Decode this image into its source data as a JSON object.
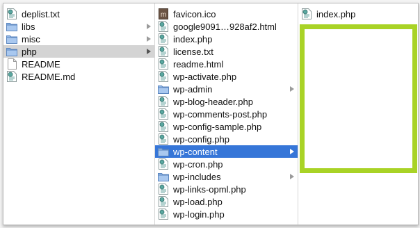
{
  "columns": {
    "col1": [
      {
        "label": "deplist.txt",
        "icon": "script-file-icon"
      },
      {
        "label": "libs",
        "icon": "folder-icon",
        "folder": true
      },
      {
        "label": "misc",
        "icon": "folder-icon",
        "folder": true
      },
      {
        "label": "php",
        "icon": "folder-icon",
        "folder": true,
        "selected": "gray"
      },
      {
        "label": "README",
        "icon": "blank-file-icon"
      },
      {
        "label": "README.md",
        "icon": "script-file-icon"
      }
    ],
    "col2": [
      {
        "label": "favicon.ico",
        "icon": "ico-file-icon"
      },
      {
        "label": "google9091…928af2.html",
        "icon": "script-file-icon"
      },
      {
        "label": "index.php",
        "icon": "script-file-icon"
      },
      {
        "label": "license.txt",
        "icon": "script-file-icon"
      },
      {
        "label": "readme.html",
        "icon": "script-file-icon"
      },
      {
        "label": "wp-activate.php",
        "icon": "script-file-icon"
      },
      {
        "label": "wp-admin",
        "icon": "folder-icon",
        "folder": true
      },
      {
        "label": "wp-blog-header.php",
        "icon": "script-file-icon"
      },
      {
        "label": "wp-comments-post.php",
        "icon": "script-file-icon"
      },
      {
        "label": "wp-config-sample.php",
        "icon": "script-file-icon"
      },
      {
        "label": "wp-config.php",
        "icon": "script-file-icon"
      },
      {
        "label": "wp-content",
        "icon": "folder-icon",
        "folder": true,
        "selected": "blue"
      },
      {
        "label": "wp-cron.php",
        "icon": "script-file-icon"
      },
      {
        "label": "wp-includes",
        "icon": "folder-icon",
        "folder": true
      },
      {
        "label": "wp-links-opml.php",
        "icon": "script-file-icon"
      },
      {
        "label": "wp-load.php",
        "icon": "script-file-icon"
      },
      {
        "label": "wp-login.php",
        "icon": "script-file-icon"
      }
    ],
    "col3": [
      {
        "label": "index.php",
        "icon": "script-file-icon"
      }
    ]
  },
  "colors": {
    "selection_blue": "#3676d8",
    "selection_gray": "#d4d4d4",
    "highlight_green": "#a9d326",
    "folder_blue": "#8fb6e6"
  }
}
